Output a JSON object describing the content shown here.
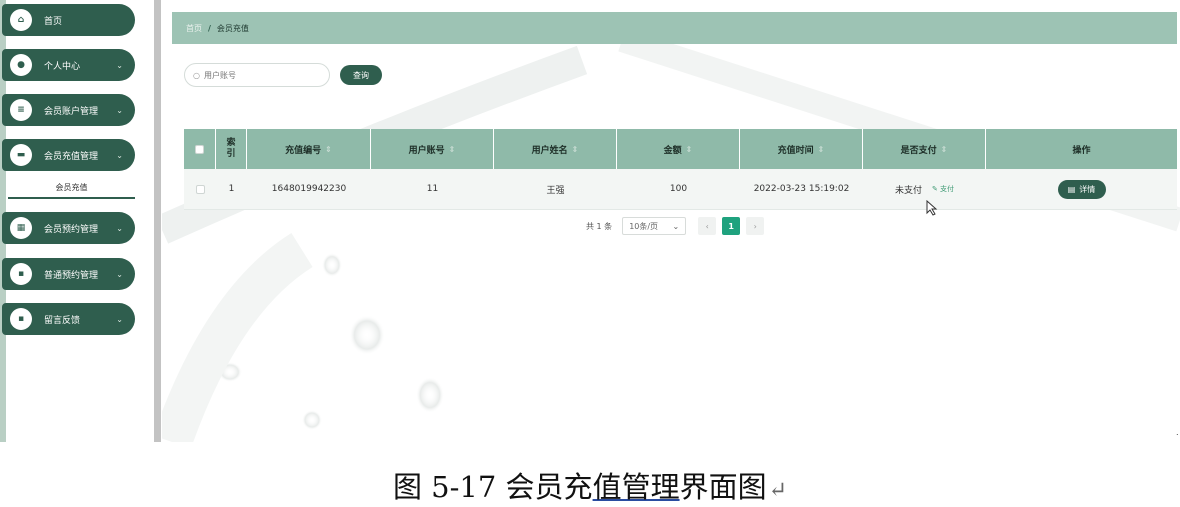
{
  "sidebar": {
    "items": [
      {
        "label": "首页",
        "icon": "home-icon",
        "glyph": "⌂",
        "chevron": ""
      },
      {
        "label": "个人中心",
        "icon": "user-icon",
        "glyph": "●",
        "chevron": "⌄"
      },
      {
        "label": "会员账户管理",
        "icon": "sliders-icon",
        "glyph": "≡",
        "chevron": "⌄"
      },
      {
        "label": "会员充值管理",
        "icon": "wallet-icon",
        "glyph": "▬",
        "chevron": "⌄"
      },
      {
        "label": "会员预约管理",
        "icon": "grid-icon",
        "glyph": "▦",
        "chevron": "⌄"
      },
      {
        "label": "普通预约管理",
        "icon": "apps-icon",
        "glyph": "▪",
        "chevron": "⌄"
      },
      {
        "label": "留言反馈",
        "icon": "chat-icon",
        "glyph": "▪",
        "chevron": "⌄"
      }
    ],
    "submenu": "会员充值"
  },
  "breadcrumb": {
    "home": "首页",
    "sep": "/",
    "current": "会员充值"
  },
  "search": {
    "placeholder": "用户账号",
    "button": "查询"
  },
  "table": {
    "headers": [
      "",
      "索引",
      "充值编号",
      "用户账号",
      "用户姓名",
      "金额",
      "充值时间",
      "是否支付",
      "操作"
    ],
    "rows": [
      {
        "index": "1",
        "code": "1648019942230",
        "account": "11",
        "name": "王强",
        "amount": "100",
        "time": "2022-03-23 15:19:02",
        "paid": "未支付",
        "pay_action": "支付",
        "detail": "详情"
      }
    ]
  },
  "pagination": {
    "total": "共 1 条",
    "page_size": "10条/页",
    "current": "1",
    "prev": "‹",
    "next": "›"
  },
  "caption": {
    "prefix": "图 5-17 会员充",
    "underlined": "值管理",
    "suffix": "界面图",
    "return_mark": "↵"
  },
  "colors": {
    "primary": "#2f5e4e",
    "header": "#9dc3b4",
    "table_header": "#8fbaa9",
    "accent": "#1fa27e"
  }
}
